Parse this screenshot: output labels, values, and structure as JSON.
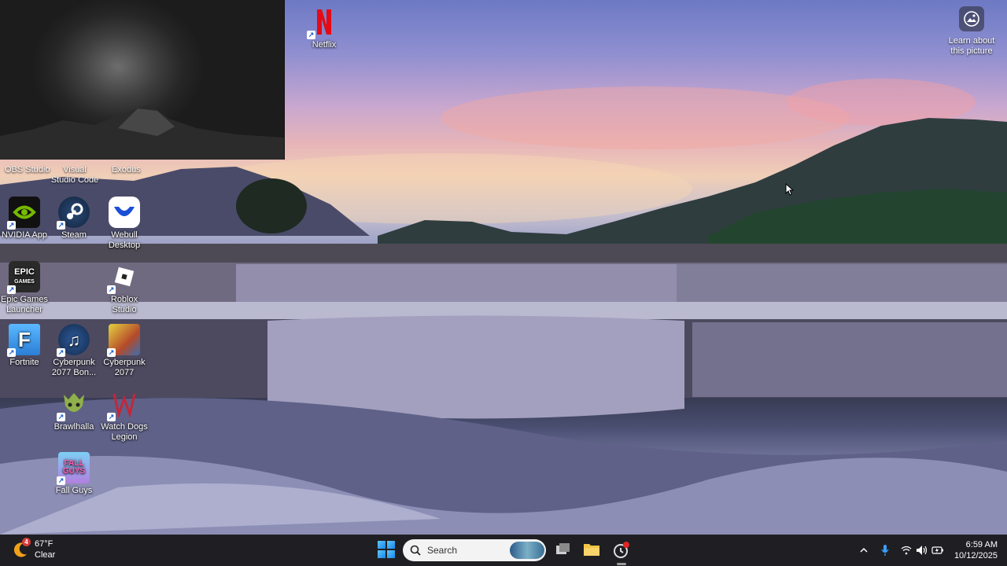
{
  "desktop": {
    "icons": [
      {
        "id": "netflix",
        "label": "Netflix",
        "icon": "netflix-icon",
        "color": "#e50914"
      },
      {
        "id": "nvidia",
        "label": "NVIDIA App",
        "icon": "nvidia-icon",
        "color": "#76b900"
      },
      {
        "id": "steam",
        "label": "Steam",
        "icon": "steam-icon",
        "color": "#1b2838"
      },
      {
        "id": "webull",
        "label": "Webull Desktop",
        "icon": "webull-icon",
        "color": "#1a4fd6"
      },
      {
        "id": "epic",
        "label": "Epic Games Launcher",
        "icon": "epic-games-icon",
        "color": "#2a2a2a"
      },
      {
        "id": "roblox",
        "label": "Roblox Studio",
        "icon": "roblox-icon",
        "color": "#ffffff"
      },
      {
        "id": "fortnite",
        "label": "Fortnite",
        "icon": "fortnite-icon",
        "color": "#3aa3f5"
      },
      {
        "id": "cyberpunk_bonus",
        "label": "Cyberpunk 2077 Bon...",
        "icon": "music-note-icon",
        "color": "#1d3b6e"
      },
      {
        "id": "cyberpunk",
        "label": "Cyberpunk 2077",
        "icon": "cyberpunk-icon",
        "color": "#d6c23a"
      },
      {
        "id": "brawlhalla",
        "label": "Brawlhalla",
        "icon": "brawlhalla-icon",
        "color": "#7a9a3b"
      },
      {
        "id": "watchdogs",
        "label": "Watch Dogs Legion",
        "icon": "watch-dogs-icon",
        "color": "#c0283b"
      },
      {
        "id": "fallguys",
        "label": "Fall Guys",
        "icon": "fall-guys-icon",
        "color": "#6fc3f0"
      }
    ],
    "partial_labels": [
      {
        "id": "obs",
        "label": "OBS Studio"
      },
      {
        "id": "vscode",
        "label": "Visual Studio Code"
      },
      {
        "id": "exodus",
        "label": "Exodus"
      }
    ],
    "learn_about": {
      "label": "Learn about this picture",
      "icon": "camera-icon"
    }
  },
  "taskbar": {
    "weather": {
      "temp": "67°F",
      "condition": "Clear",
      "badge": "4"
    },
    "search": {
      "placeholder": "Search"
    },
    "apps": [
      "task-view-icon",
      "file-explorer-icon",
      "recording-app-icon"
    ],
    "tray_icons": [
      "chevron-up-icon",
      "microphone-icon",
      "wifi-icon",
      "volume-icon",
      "battery-icon"
    ],
    "clock": {
      "time": "6:59 AM",
      "date": "10/12/2025"
    }
  }
}
